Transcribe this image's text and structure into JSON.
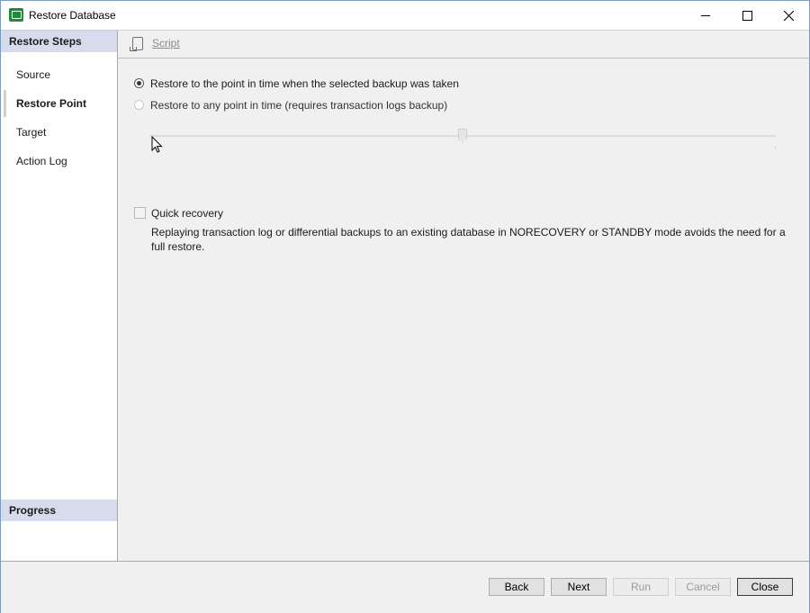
{
  "window": {
    "title": "Restore Database"
  },
  "sidebar": {
    "steps_header": "Restore Steps",
    "steps": [
      {
        "label": "Source"
      },
      {
        "label": "Restore Point"
      },
      {
        "label": "Target"
      },
      {
        "label": "Action Log"
      }
    ],
    "active_step": "Restore Point",
    "progress_header": "Progress"
  },
  "toolbar": {
    "script_label": "Script",
    "script_icon": "script-icon"
  },
  "options": {
    "restore_selected_label": "Restore to the point in time when the selected backup was taken",
    "restore_any_label": "Restore to any point in time (requires transaction logs backup)",
    "selected_option": "restore_selected",
    "slider_level": 0.5
  },
  "quick_recovery": {
    "label": "Quick recovery",
    "checked": false,
    "description": "Replaying transaction log or differential backups to an existing database in NORECOVERY or STANDBY mode avoids the need for a full restore."
  },
  "buttons": {
    "back": "Back",
    "next": "Next",
    "run": "Run",
    "cancel": "Cancel",
    "close": "Close"
  },
  "colors": {
    "app_icon": "#1f8a3a",
    "sidebar_header": "#d6dcec",
    "window_background": "#f0f0f0"
  }
}
